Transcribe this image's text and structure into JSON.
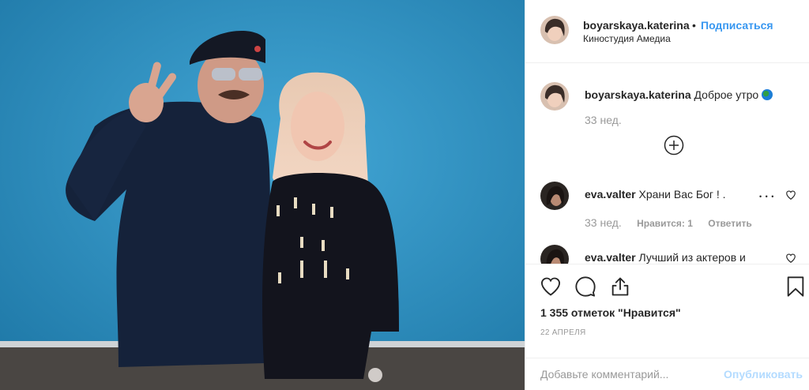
{
  "post": {
    "username": "boyarskaya.katerina",
    "header_username": "boyarskaya.katerina",
    "dot": "•",
    "follow_label": "Подписаться",
    "location": "Киностудия Амедиа"
  },
  "caption": {
    "username": "boyarskaya.katerina",
    "text": "Доброе утро",
    "emoji": "globe-emoji",
    "time": "33 нед."
  },
  "comments": [
    {
      "username": "eva.valter",
      "text": "Храни Вас Бог ! .",
      "time": "33 нед.",
      "likes": "Нравится: 1",
      "reply": "Ответить",
      "more": "• • •"
    },
    {
      "username": "eva.valter",
      "text": "Лучший из актеров и"
    }
  ],
  "actions": {
    "icons": [
      "heart-icon",
      "comment-icon",
      "share-icon",
      "bookmark-icon"
    ],
    "likes_count": "1 355 отметок \"Нравится\"",
    "date": "22 АПРЕЛЯ"
  },
  "comment_box": {
    "placeholder": "Добавьте комментарий...",
    "publish_label": "Опубликовать"
  },
  "colors": {
    "accent": "#3897f0",
    "publish_disabled": "#b3dbff",
    "background_photo": "#2f8fbf"
  }
}
